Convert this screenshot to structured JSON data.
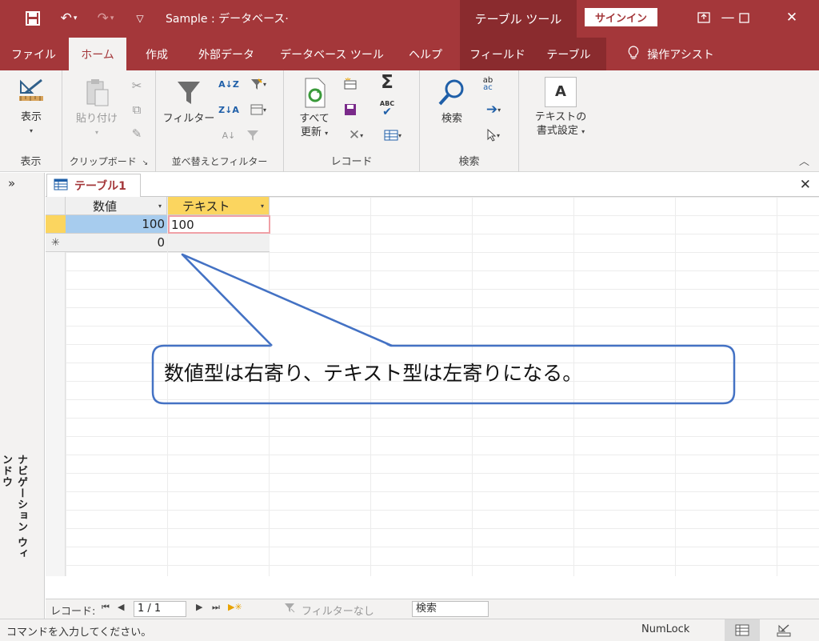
{
  "titlebar": {
    "title": "Sample : データベース·",
    "context_tools": "テーブル ツール",
    "signin": "サインイン"
  },
  "tabs": {
    "file": "ファイル",
    "home": "ホーム",
    "create": "作成",
    "external": "外部データ",
    "dbtools": "データベース ツール",
    "help": "ヘルプ",
    "fields": "フィールド",
    "table": "テーブル",
    "tellme": "操作アシスト"
  },
  "ribbon": {
    "view_btn": "表示",
    "view_group": "表示",
    "paste_btn": "貼り付け",
    "clipboard_group": "クリップボード",
    "filter_btn": "フィルター",
    "sortfilter_group": "並べ替えとフィルター",
    "refresh_btn_line1": "すべて",
    "refresh_btn_line2": "更新",
    "records_group": "レコード",
    "find_btn": "検索",
    "find_group": "検索",
    "textformat_line1": "テキストの",
    "textformat_line2": "書式設定",
    "sigma": "Σ",
    "abc": "ABC",
    "ab": "ab",
    "ac": "ac",
    "font_a": "A"
  },
  "navpane": {
    "expand": "»",
    "title": "ナビゲーション ウィンドウ"
  },
  "document": {
    "tab_label": "テーブル1",
    "close": "✕"
  },
  "grid": {
    "columns": [
      "数値",
      "テキスト"
    ],
    "rows": [
      {
        "num": "100",
        "text": "100"
      }
    ],
    "new_row_marker": "✳",
    "new_row_num": "0"
  },
  "recnav": {
    "label": "レコード:",
    "position": "1 / 1",
    "filter": "フィルターなし",
    "search": "検索"
  },
  "status": {
    "message": "コマンドを入力してください。",
    "numlock": "NumLock"
  },
  "callout": {
    "text": "数値型は右寄り、テキスト型は左寄りになる。"
  },
  "colors": {
    "accent": "#a4373a",
    "context": "#8a2b2e",
    "callout_border": "#4472c4",
    "selection": "#a7ccee"
  }
}
